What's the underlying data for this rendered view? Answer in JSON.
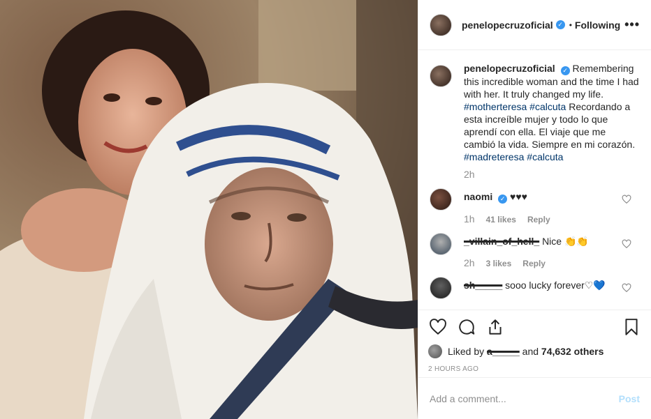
{
  "post": {
    "username": "penelopecruzoficial",
    "following_label": "Following",
    "more_label": "•••"
  },
  "caption": {
    "username": "penelopecruzoficial",
    "text_1": "Remembering this incredible woman and the time I had with her. It truly changed my life.",
    "tag_1": "#motherteresa",
    "tag_2": "#calcuta",
    "text_2": "Recordando a esta increíble mujer y todo lo que aprendí con ella. El viaje que me cambió la vida. Siempre en mi corazón.",
    "tag_3": "#madreteresa",
    "tag_4": "#calcuta",
    "time": "2h"
  },
  "comments": [
    {
      "username": "naomi",
      "verified": true,
      "text": "♥♥♥",
      "time": "1h",
      "likes": "41 likes",
      "reply": "Reply"
    },
    {
      "username": "_villain_of_hell_",
      "verified": false,
      "text": "Nice 👏👏",
      "time": "2h",
      "likes": "3 likes",
      "reply": "Reply"
    },
    {
      "username": "sh_____",
      "verified": false,
      "text": "sooo lucky forever♡💙",
      "time": "",
      "likes": "",
      "reply": ""
    }
  ],
  "likes": {
    "prefix": "Liked by",
    "user": "a_____",
    "middle": "and",
    "count": "74,632 others"
  },
  "timestamp": "2 HOURS AGO",
  "add_comment": {
    "placeholder": "Add a comment...",
    "post_label": "Post"
  },
  "colors": {
    "verified": "#3897f0",
    "hashtag": "#003569",
    "muted": "#8e8e8e",
    "post_disabled": "#b2dffc"
  },
  "icons": [
    "heart-icon",
    "comment-icon",
    "share-icon",
    "bookmark-icon",
    "verified-icon",
    "more-icon"
  ]
}
